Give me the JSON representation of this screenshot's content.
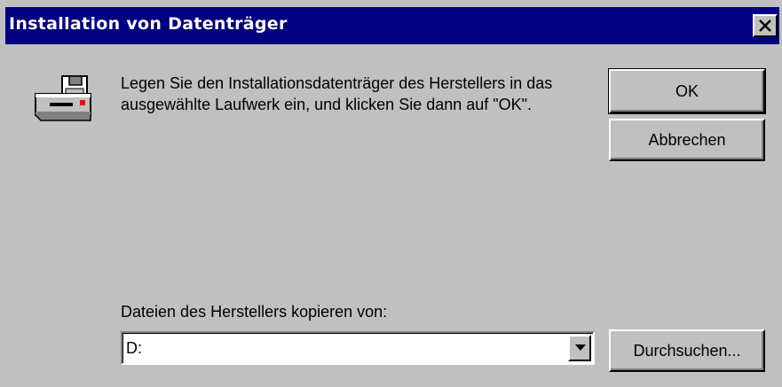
{
  "window": {
    "title": "Installation von Datenträger",
    "close_icon": "close-icon"
  },
  "message": {
    "icon": "disk-drive-icon",
    "text": "Legen Sie den Installationsdatenträger des Herstellers in das ausgewählte Laufwerk ein, und klicken Sie dann auf \"OK\"."
  },
  "buttons": {
    "ok_label": "OK",
    "cancel_label": "Abbrechen",
    "browse_label": "Durchsuchen..."
  },
  "copy_from": {
    "label": "Dateien des Herstellers kopieren von:",
    "value": "D:",
    "dropdown_icon": "chevron-down-icon"
  },
  "colors": {
    "title_bar": "#000080",
    "face": "#c0c0c0"
  }
}
